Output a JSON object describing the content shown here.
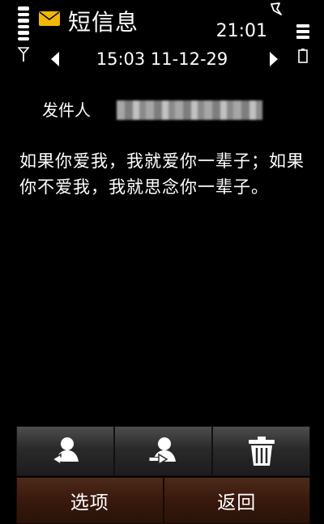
{
  "status_bar": {
    "app_title": "短信息",
    "clock": "21:01"
  },
  "icons": {
    "signal": "signal-strength-icon",
    "envelope": "envelope-icon",
    "alarm": "alarm-icon",
    "antenna": "antenna-icon",
    "battery": "battery-icon",
    "battery_level": "battery-level-icon",
    "prev": "previous-arrow-icon",
    "next": "next-arrow-icon",
    "reply": "contact-reply-icon",
    "forward": "contact-forward-icon",
    "delete": "trash-icon"
  },
  "colors": {
    "background": "#000000",
    "envelope": "#f0b800",
    "softkey": "#3a1a0c",
    "toolbar": "#2c2c2c"
  },
  "message": {
    "datetime": "15:03 11-12-29",
    "sender_label": "发件人",
    "body": "如果你爱我，我就爱你一辈子；如果你不爱我，我就思念你一辈子。"
  },
  "softkeys": {
    "left": "选项",
    "right": "返回"
  }
}
